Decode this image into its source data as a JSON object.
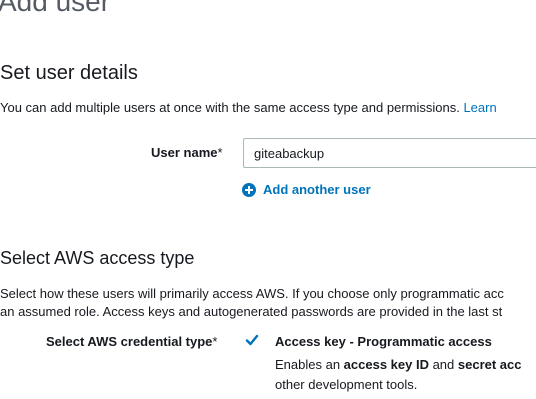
{
  "page": {
    "title": "Add user"
  },
  "user_details": {
    "heading": "Set user details",
    "description": "You can add multiple users at once with the same access type and permissions.",
    "learn_link": "Learn",
    "username_label": "User name",
    "required_mark": "*",
    "username_value": "giteabackup",
    "add_another_label": "Add another user"
  },
  "access_type": {
    "heading": "Select AWS access type",
    "description_line1": "Select how these users will primarily access AWS. If you choose only programmatic acc",
    "description_line2": "an assumed role. Access keys and autogenerated passwords are provided in the last st",
    "credential_label": "Select AWS credential type",
    "required_mark": "*",
    "option": {
      "checked": true,
      "title": "Access key - Programmatic access",
      "desc_part1": "Enables an ",
      "desc_bold1": "access key ID",
      "desc_part2": " and ",
      "desc_bold2": "secret acc",
      "desc_line2": "other development tools."
    }
  },
  "colors": {
    "link": "#0073bb",
    "text": "#16191f",
    "muted_title": "#545b64"
  },
  "icons": {
    "add": "plus-circle-icon",
    "check": "checkmark-icon"
  }
}
